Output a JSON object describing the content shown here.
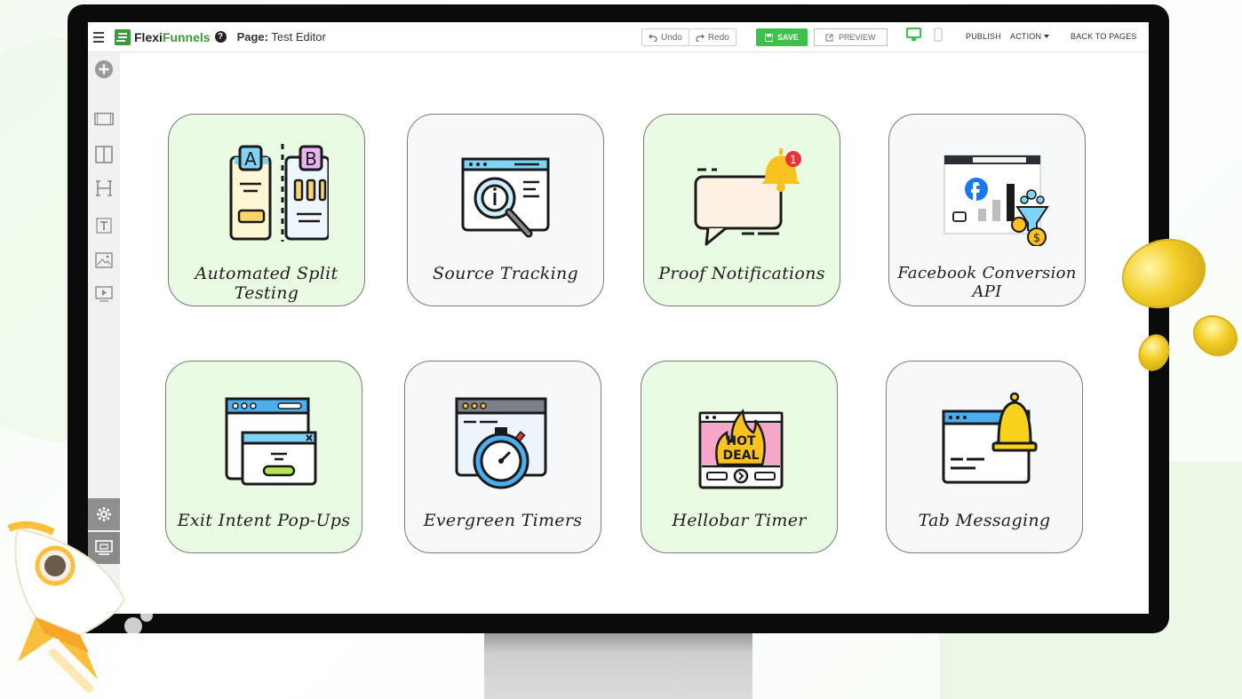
{
  "app": {
    "logo_prefix": "Flexi",
    "logo_accent": "Funnels",
    "help_glyph": "?",
    "page_label": "Page:",
    "page_name": "Test Editor"
  },
  "toolbar": {
    "undo": "Undo",
    "redo": "Redo",
    "save": "SAVE",
    "preview": "PREVIEW",
    "publish": "PUBLISH",
    "action": "ACTION",
    "back": "BACK TO PAGES"
  },
  "sidebar": {
    "items": [
      "add-icon",
      "section-icon",
      "columns-icon",
      "heading-icon",
      "text-icon",
      "image-icon",
      "video-icon"
    ],
    "bottom": [
      "gear-icon",
      "screen-icon"
    ]
  },
  "cards": [
    {
      "title": "Automated Split Testing",
      "theme": "green",
      "icon": "ab-test-icon"
    },
    {
      "title": "Source Tracking",
      "theme": "gray",
      "icon": "magnifier-window-icon"
    },
    {
      "title": "Proof Notifications",
      "theme": "green",
      "icon": "chat-bell-icon"
    },
    {
      "title": "Facebook Conversion API",
      "theme": "gray",
      "icon": "facebook-funnel-icon"
    },
    {
      "title": "Exit Intent Pop-Ups",
      "theme": "green",
      "icon": "popup-window-icon"
    },
    {
      "title": "Evergreen Timers",
      "theme": "gray",
      "icon": "stopwatch-window-icon"
    },
    {
      "title": "Hellobar Timer",
      "theme": "green",
      "icon": "hot-deal-icon"
    },
    {
      "title": "Tab Messaging",
      "theme": "gray",
      "icon": "bell-window-icon"
    }
  ],
  "hot_deal_line1": "HOT",
  "hot_deal_line2": "DEAL",
  "notification_count": "1",
  "colors": {
    "accent": "#3cc24a",
    "card_green": "#e9fbe2",
    "card_gray": "#f7f8fa"
  }
}
